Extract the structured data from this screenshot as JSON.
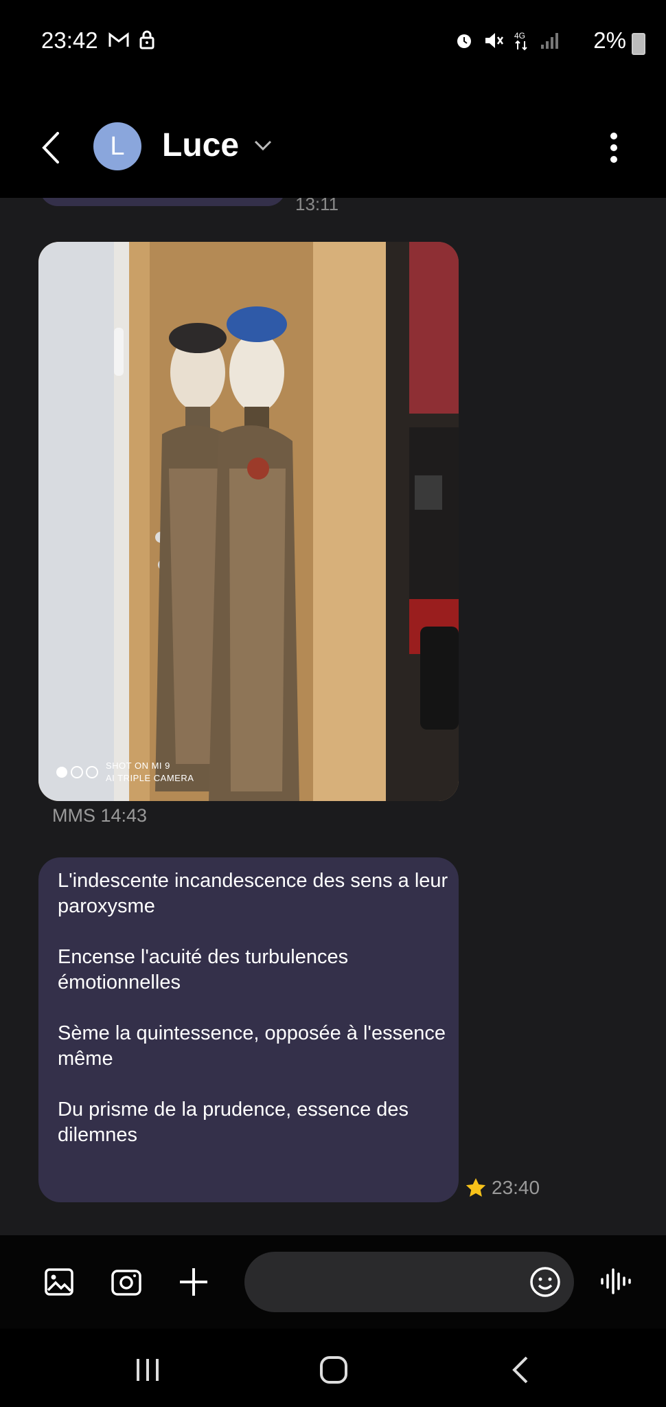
{
  "status_bar": {
    "time": "23:42",
    "battery": "2%",
    "left_icons": [
      "gmail-icon",
      "lock-icon"
    ],
    "right_icons": [
      "alarm-icon",
      "mute-icon",
      "network-4g-icon",
      "signal-icon",
      "battery-charging-icon"
    ]
  },
  "header": {
    "avatar_letter": "L",
    "contact_name": "Luce",
    "avatar_color": "#8aa6dc"
  },
  "chat": {
    "previous_message_time": "13:11",
    "photo": {
      "watermark_line1": "SHOT ON MI 9",
      "watermark_line2": "AI TRIPLE CAMERA"
    },
    "mms_time": "MMS 14:43",
    "message": {
      "text": "L'indescente incandescence des sens a leur paroxysme\n\nEncense l'acuité des turbulences émotionnelles\n\nSème la quintessence, opposée à l'essence même\n\nDu prisme de la prudence, essence des dilemnes",
      "time": "23:40",
      "starred": true
    },
    "bubble_color": "#34304a"
  },
  "composer": {
    "input_value": "",
    "buttons": [
      "gallery-icon",
      "camera-icon",
      "plus-icon",
      "emoji-icon",
      "voice-icon"
    ]
  },
  "navbar": {
    "buttons": [
      "recents-icon",
      "home-icon",
      "back-icon"
    ]
  }
}
